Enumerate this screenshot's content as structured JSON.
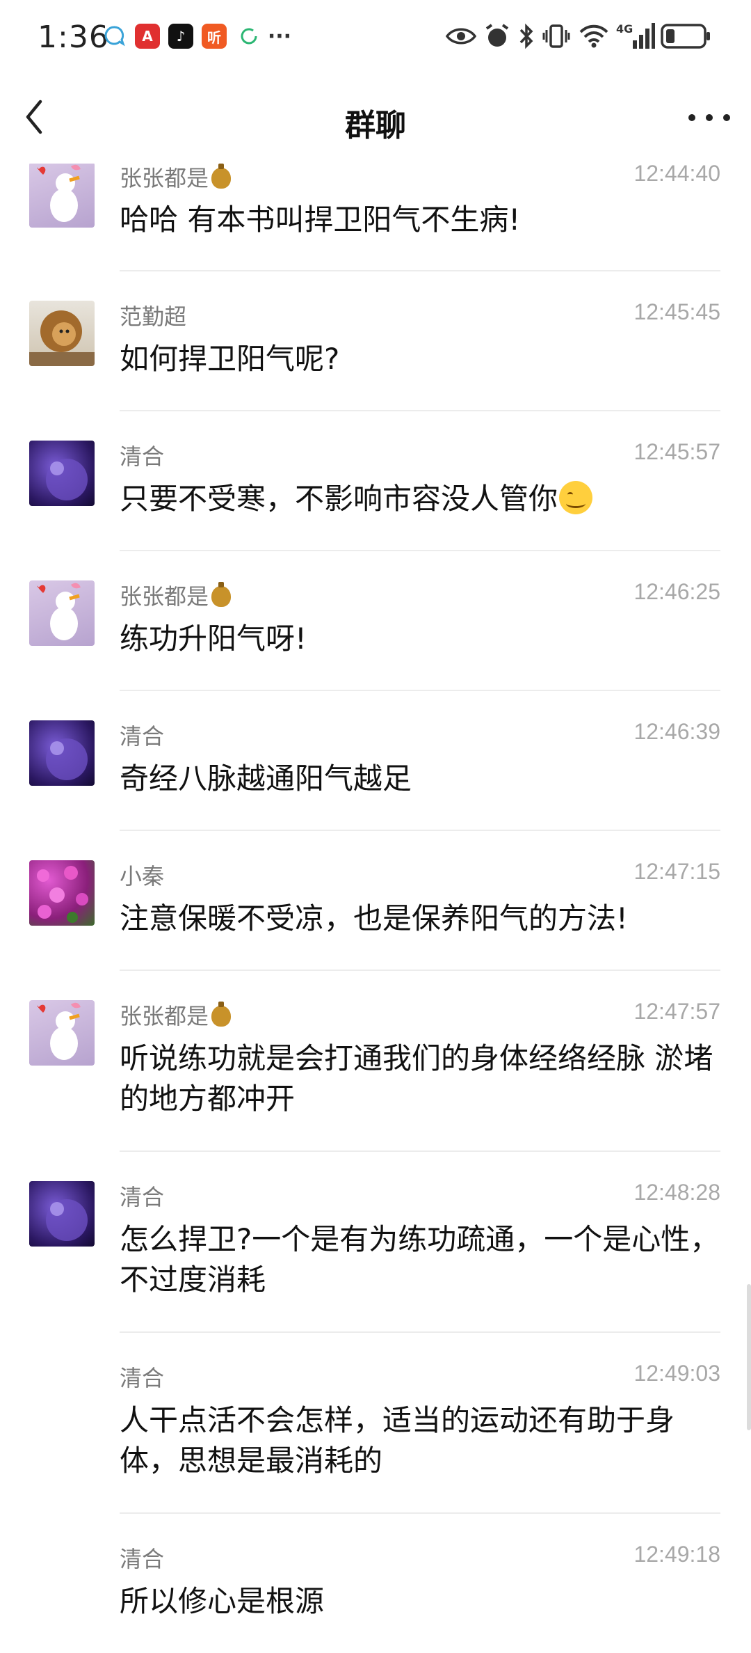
{
  "status_bar": {
    "time": "1:36",
    "network": "4G",
    "icons": [
      "chat-bubble-icon",
      "app-red-icon",
      "tiktok-icon",
      "listen-app-icon",
      "sync-icon",
      "more-dots-icon",
      "eye-icon",
      "alarm-icon",
      "bluetooth-icon",
      "vibrate-icon",
      "wifi-icon",
      "signal-icon",
      "battery-icon"
    ],
    "notification_more": "···",
    "listen_app_label": "听"
  },
  "nav": {
    "title": "群聊",
    "back_icon": "chevron-left-icon",
    "more_icon": "more-dots-icon"
  },
  "messages": [
    {
      "sender": "张张都是",
      "sender_badge": "money-bag-emoji",
      "time": "12:44:40",
      "text": "哈哈 有本书叫捍卫阳气不生病!",
      "avatar": "daisy-duck-avatar"
    },
    {
      "sender": "范勤超",
      "time": "12:45:45",
      "text": "如何捍卫阳气呢?",
      "avatar": "lion-avatar"
    },
    {
      "sender": "清合",
      "time": "12:45:57",
      "text": "只要不受寒，不影响市容没人管你",
      "emoji": "smile-emoji",
      "avatar": "purple-planet-avatar"
    },
    {
      "sender": "张张都是",
      "sender_badge": "money-bag-emoji",
      "time": "12:46:25",
      "text": "练功升阳气呀!",
      "avatar": "daisy-duck-avatar"
    },
    {
      "sender": "清合",
      "time": "12:46:39",
      "text": "奇经八脉越通阳气越足",
      "avatar": "purple-planet-avatar"
    },
    {
      "sender": "小秦",
      "time": "12:47:15",
      "text": "注意保暖不受凉，也是保养阳气的方法!",
      "avatar": "pink-flowers-avatar"
    },
    {
      "sender": "张张都是",
      "sender_badge": "money-bag-emoji",
      "time": "12:47:57",
      "text": "听说练功就是会打通我们的身体经络经脉 淤堵的地方都冲开",
      "avatar": "daisy-duck-avatar"
    },
    {
      "sender": "清合",
      "time": "12:48:28",
      "text": "怎么捍卫?一个是有为练功疏通，一个是心性，不过度消耗",
      "avatar": "purple-planet-avatar"
    },
    {
      "sender": "清合",
      "time": "12:49:03",
      "text": "人干点活不会怎样，适当的运动还有助于身体，思想是最消耗的",
      "avatar": ""
    },
    {
      "sender": "清合",
      "time": "12:49:18",
      "text": "所以修心是根源",
      "avatar": ""
    }
  ],
  "colors": {
    "background": "#ffffff",
    "name": "#7a7a7a",
    "time": "#a8a8a8",
    "divider": "#ececec"
  }
}
